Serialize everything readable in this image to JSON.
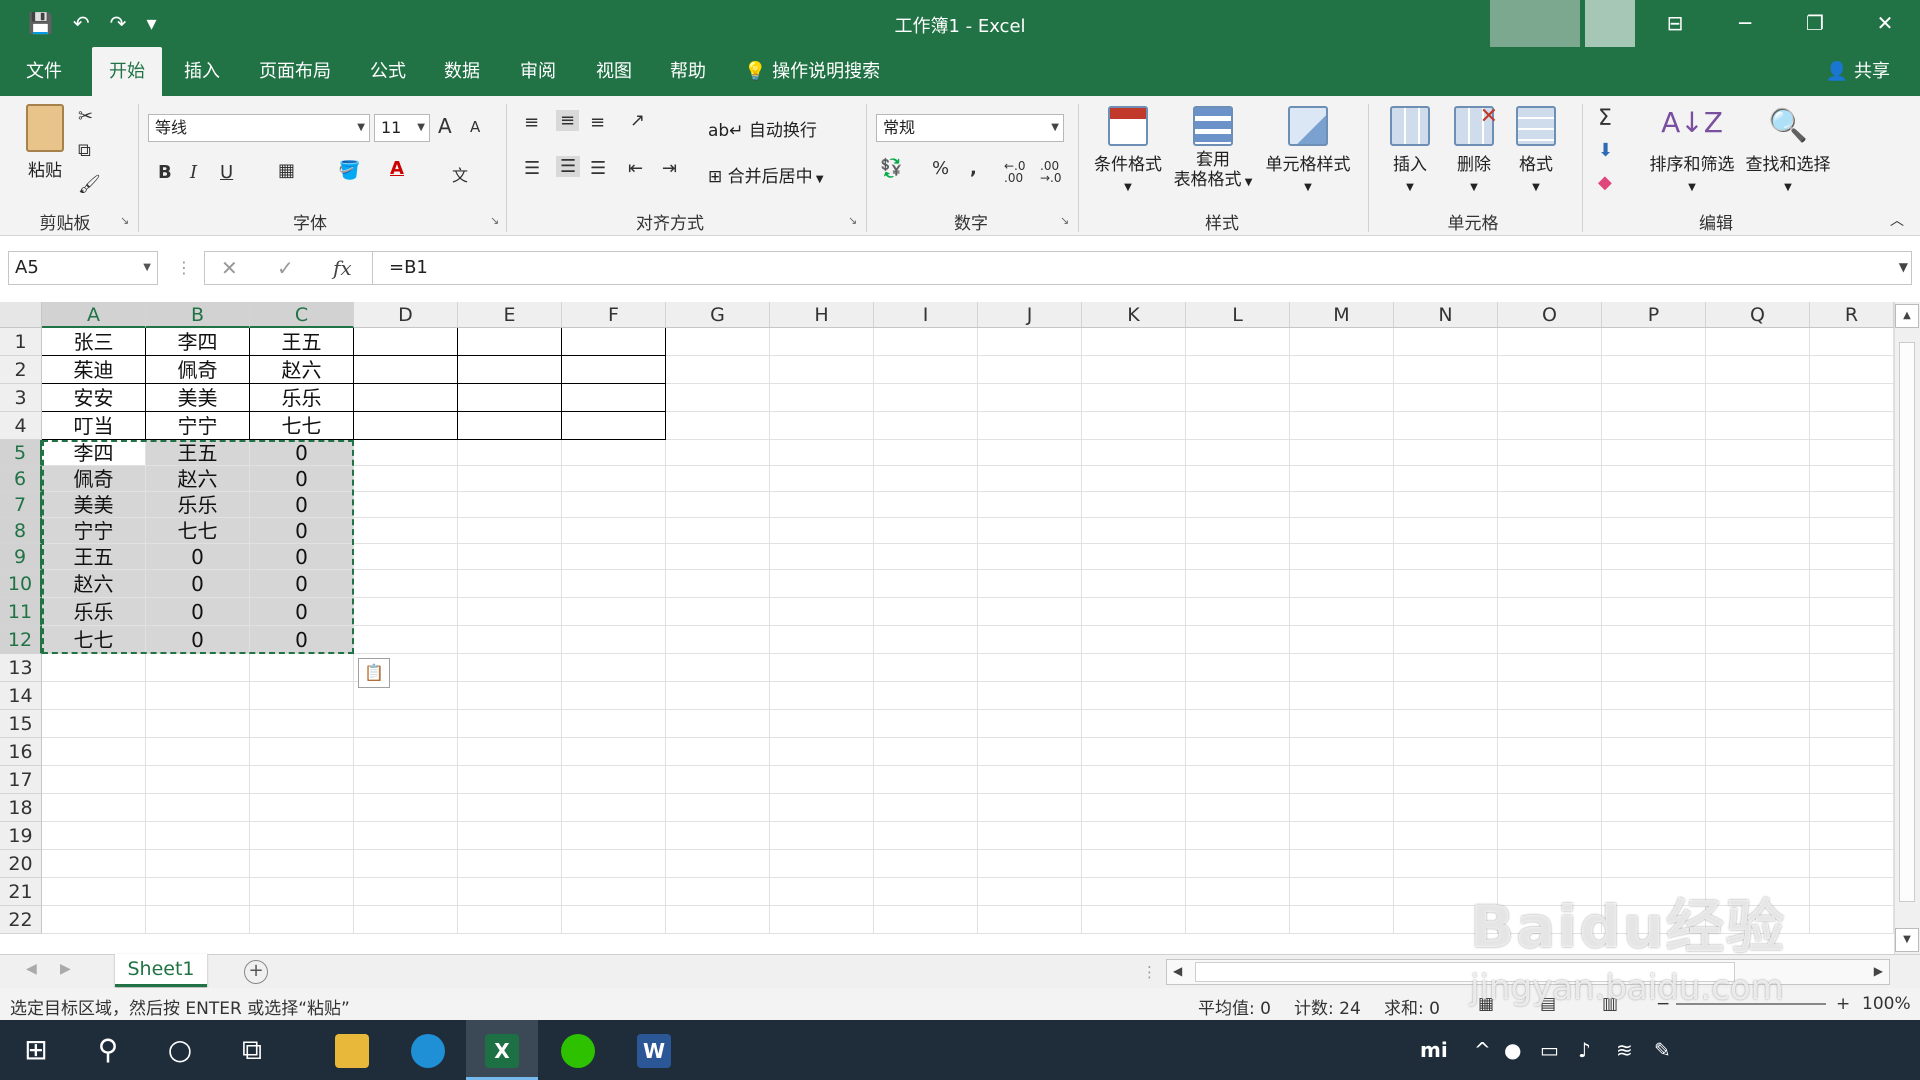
{
  "window": {
    "title": "工作簿1 - Excel",
    "controls": [
      "⊟",
      "─",
      "❐",
      "✕"
    ]
  },
  "quick_access": [
    "💾",
    "↶",
    "↷",
    "▾"
  ],
  "tabs": [
    "文件",
    "开始",
    "插入",
    "页面布局",
    "公式",
    "数据",
    "审阅",
    "视图",
    "帮助"
  ],
  "active_tab": "开始",
  "tell_me": "操作说明搜索",
  "share": "共享",
  "ribbon": {
    "clipboard": {
      "paste": "粘贴",
      "label": "剪贴板"
    },
    "font": {
      "name": "等线",
      "size": "11",
      "label": "字体",
      "bold": "B",
      "italic": "I",
      "underline": "U",
      "grow": "A",
      "shrink": "A",
      "phonetic": "文"
    },
    "alignment": {
      "wrap": "自动换行",
      "merge": "合并后居中",
      "label": "对齐方式"
    },
    "number": {
      "format": "常规",
      "percent": "%",
      "comma": ",",
      "label": "数字"
    },
    "styles": {
      "cond_format": "条件格式",
      "table_format_line1": "套用",
      "table_format_line2": "表格格式",
      "cell_styles": "单元格样式",
      "label": "样式"
    },
    "cells": {
      "insert": "插入",
      "delete": "删除",
      "format": "格式",
      "label": "单元格"
    },
    "editing": {
      "sum": "Σ",
      "sort_filter": "排序和筛选",
      "find_select": "查找和选择",
      "label": "编辑"
    }
  },
  "formula_bar": {
    "name_box": "A5",
    "formula": "=B1"
  },
  "grid": {
    "columns": [
      "A",
      "B",
      "C",
      "D",
      "E",
      "F",
      "G",
      "H",
      "I",
      "J",
      "K",
      "L",
      "M",
      "N",
      "O",
      "P",
      "Q",
      "R"
    ],
    "rows": [
      "1",
      "2",
      "3",
      "4",
      "5",
      "6",
      "7",
      "8",
      "9",
      "10",
      "11",
      "12",
      "13",
      "14",
      "15",
      "16",
      "17",
      "18",
      "19",
      "20",
      "21",
      "22"
    ],
    "cells": [
      [
        "张三",
        "李四",
        "王五"
      ],
      [
        "茱迪",
        "佩奇",
        "赵六"
      ],
      [
        "安安",
        "美美",
        "乐乐"
      ],
      [
        "叮当",
        "宁宁",
        "七七"
      ],
      [
        "李四",
        "王五",
        "0"
      ],
      [
        "佩奇",
        "赵六",
        "0"
      ],
      [
        "美美",
        "乐乐",
        "0"
      ],
      [
        "宁宁",
        "七七",
        "0"
      ],
      [
        "王五",
        "0",
        "0"
      ],
      [
        "赵六",
        "0",
        "0"
      ],
      [
        "乐乐",
        "0",
        "0"
      ],
      [
        "七七",
        "0",
        "0"
      ]
    ]
  },
  "sheet_tabs": [
    "Sheet1"
  ],
  "status": {
    "message": "选定目标区域，然后按 ENTER 或选择“粘贴”",
    "average": "平均值: 0",
    "count": "计数: 24",
    "sum": "求和: 0",
    "zoom": "100%"
  },
  "watermark": {
    "brand": "Baidu经验",
    "url": "jingyan.baidu.com"
  }
}
